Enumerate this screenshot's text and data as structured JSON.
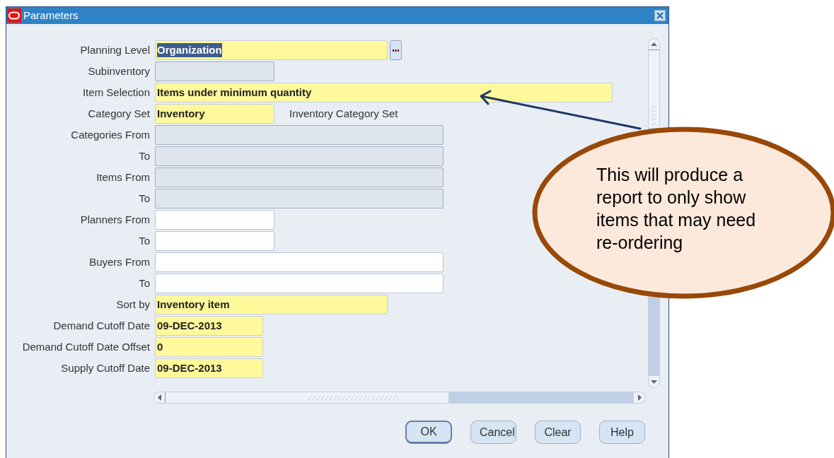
{
  "window": {
    "title": "Parameters"
  },
  "fields": [
    {
      "label": "Planning Level",
      "value": "Organization",
      "required": true,
      "disabled": false,
      "highlighted": true,
      "has_lov": true
    },
    {
      "label": "Subinventory",
      "required": false,
      "disabled": true
    },
    {
      "label": "Item Selection",
      "value": "Items under minimum quantity",
      "required": true,
      "disabled": false
    },
    {
      "label": "Category Set",
      "value": "Inventory",
      "required": true,
      "disabled": false,
      "description": "Inventory Category Set"
    },
    {
      "label": "Categories From",
      "required": false,
      "disabled": true
    },
    {
      "label": "To",
      "required": false,
      "disabled": true
    },
    {
      "label": "Items From",
      "required": false,
      "disabled": true
    },
    {
      "label": "To",
      "required": false,
      "disabled": true
    },
    {
      "label": "Planners From",
      "required": false,
      "disabled": false
    },
    {
      "label": "To",
      "required": false,
      "disabled": false
    },
    {
      "label": "Buyers From",
      "required": false,
      "disabled": false
    },
    {
      "label": "To",
      "required": false,
      "disabled": false
    },
    {
      "label": "Sort by",
      "value": "Inventory item",
      "required": true,
      "disabled": false
    },
    {
      "label": "Demand Cutoff Date",
      "value": "09-DEC-2013",
      "required": true,
      "disabled": false
    },
    {
      "label": "Demand Cutoff Date Offset",
      "value": "0",
      "required": true,
      "disabled": false
    },
    {
      "label": "Supply Cutoff Date",
      "value": "09-DEC-2013",
      "required": true,
      "disabled": false
    }
  ],
  "buttons": [
    {
      "label": "OK",
      "default": true
    },
    {
      "label": "Cancel",
      "default": false
    },
    {
      "label": "Clear",
      "default": false
    },
    {
      "label": "Help",
      "default": false
    }
  ],
  "callout": {
    "text": "This will produce a report to only show items that may need re-ordering"
  }
}
